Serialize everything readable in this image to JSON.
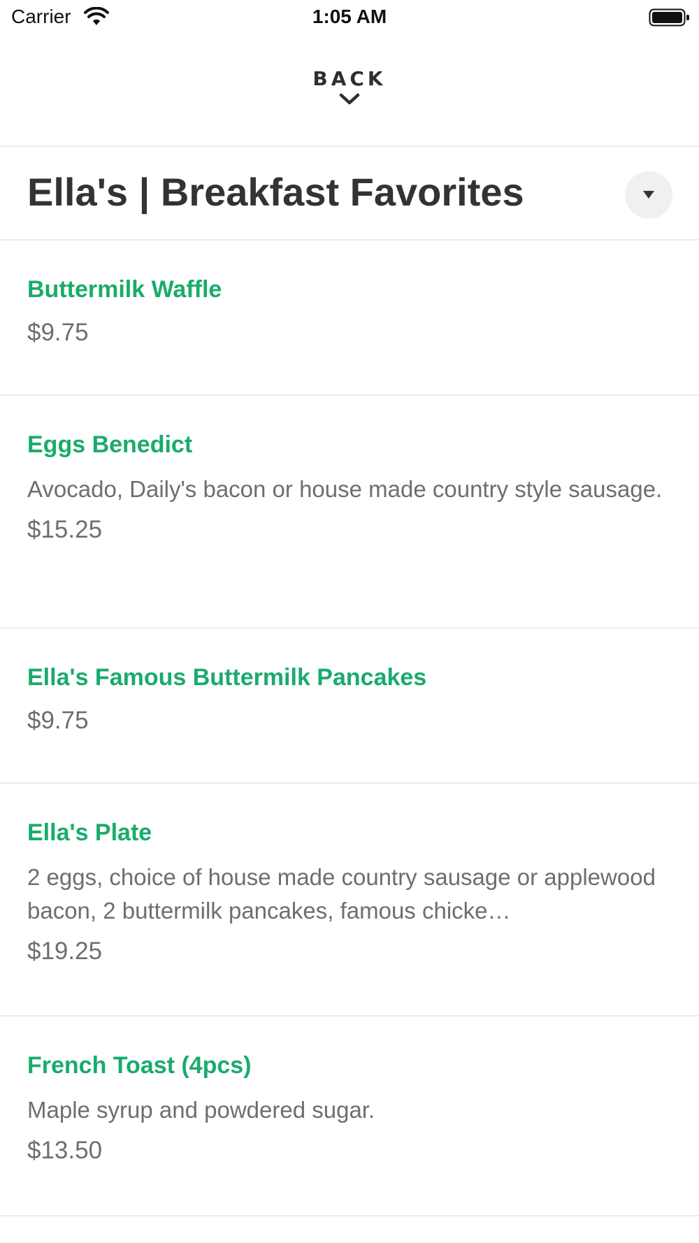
{
  "status_bar": {
    "carrier": "Carrier",
    "time": "1:05 AM",
    "wifi_icon": "wifi-icon",
    "battery_icon": "battery-icon"
  },
  "nav": {
    "back_label": "BACK",
    "back_icon": "chevron-down-icon"
  },
  "menu": {
    "title": "Ella's | Breakfast Favorites",
    "dropdown_icon": "caret-down-icon"
  },
  "items": [
    {
      "name": "Buttermilk Waffle",
      "description": "",
      "price": "$9.75"
    },
    {
      "name": "Eggs Benedict",
      "description": "Avocado, Daily's bacon or house made country style sausage.",
      "price": "$15.25"
    },
    {
      "name": "Ella's Famous Buttermilk Pancakes",
      "description": "",
      "price": "$9.75"
    },
    {
      "name": "Ella's Plate",
      "description": "2 eggs, choice of house made country sausage or applewood bacon, 2 buttermilk pancakes, famous chicke…",
      "price": "$19.25"
    },
    {
      "name": "French Toast (4pcs)",
      "description": "Maple syrup and powdered sugar.",
      "price": "$13.50"
    }
  ],
  "colors": {
    "item_name": "#1aab6c",
    "secondary_text": "#6e6e6e",
    "title_text": "#333333",
    "divider": "#ececec",
    "dropdown_bg": "#f0f0f0"
  }
}
